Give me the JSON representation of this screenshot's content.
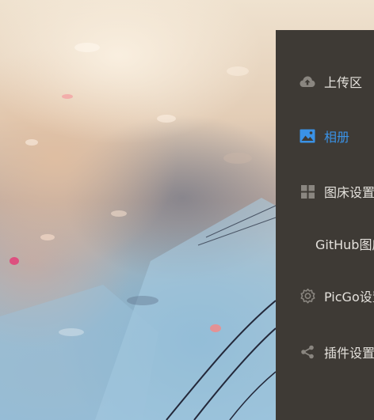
{
  "nav": {
    "items": [
      {
        "label": "上传区",
        "icon": "cloud-upload-icon",
        "active": false
      },
      {
        "label": "相册",
        "icon": "image-icon",
        "active": true
      },
      {
        "label": "图床设置",
        "icon": "grid-icon",
        "active": false
      },
      {
        "label": "GitHub图床",
        "icon": "",
        "active": false,
        "submenu": true
      },
      {
        "label": "PicGo设置",
        "icon": "gear-icon",
        "active": false
      },
      {
        "label": "插件设置",
        "icon": "share-icon",
        "active": false
      }
    ]
  },
  "colors": {
    "panel_bg": "#3e3a35",
    "text": "#e4e1dc",
    "icon": "#8a8680",
    "accent": "#3a92e6"
  }
}
